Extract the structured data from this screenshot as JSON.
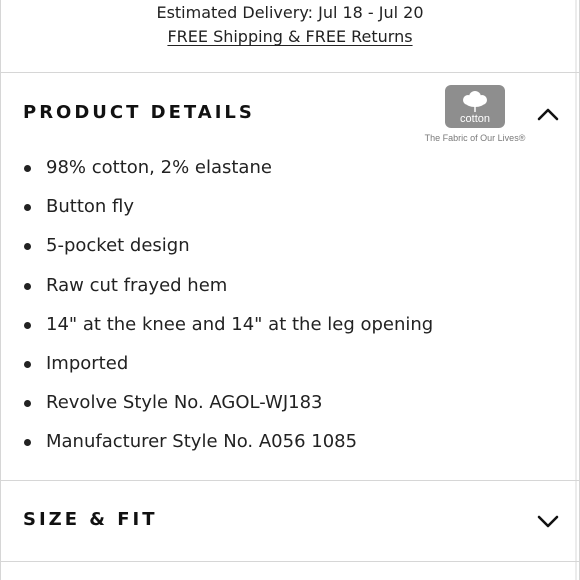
{
  "delivery": {
    "estimated": "Estimated Delivery: Jul 18 - Jul 20",
    "shipping_link": "FREE Shipping & FREE Returns"
  },
  "product_details": {
    "title": "PRODUCT DETAILS",
    "state": "expanded",
    "toggle_icon": "chevron-up-icon",
    "cotton_logo": {
      "wordmark": "cotton",
      "tagline": "The Fabric of Our Lives®",
      "color": "#8e8e8e"
    },
    "items": [
      "98% cotton, 2% elastane",
      "Button fly",
      "5-pocket design",
      "Raw cut frayed hem",
      "14\" at the knee and 14\" at the leg opening",
      "Imported",
      "Revolve Style No. AGOL-WJ183",
      "Manufacturer Style No. A056 1085"
    ]
  },
  "size_fit": {
    "title": "SIZE & FIT",
    "state": "collapsed",
    "toggle_icon": "chevron-down-icon"
  }
}
